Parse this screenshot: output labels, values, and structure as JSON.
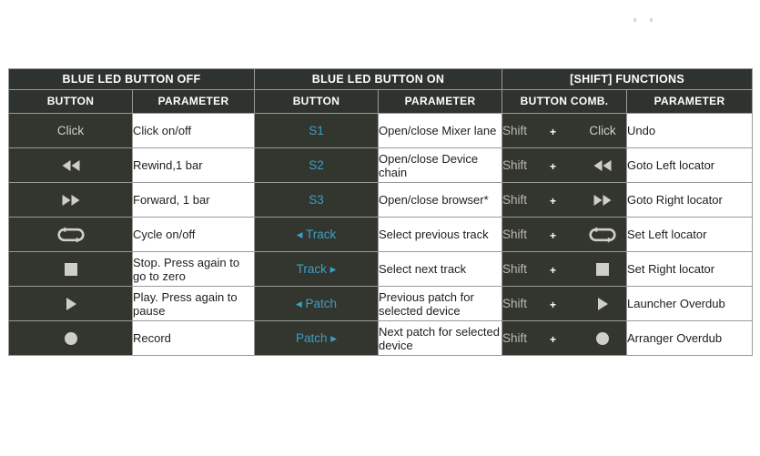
{
  "table": {
    "group_headers": [
      {
        "label": "BLUE LED BUTTON OFF",
        "span": 2
      },
      {
        "label": "BLUE LED BUTTON ON",
        "span": 2
      },
      {
        "label": "[SHIFT] FUNCTIONS",
        "span": 2
      }
    ],
    "sub_headers": [
      "BUTTON",
      "PARAMETER",
      "BUTTON",
      "PARAMETER",
      "BUTTON COMB.",
      "PARAMETER"
    ],
    "colors": {
      "dark_cell": "#32362f",
      "header_cell": "#2f332f",
      "blue_text": "#3c9fc4",
      "light_text": "#cfcfc8",
      "shift_text": "#b9b9b2",
      "border": "#9a9a9a",
      "param_bg": "#ffffff",
      "param_text": "#1d1d1d"
    },
    "rows": [
      {
        "off_button": {
          "type": "text",
          "label": "Click",
          "icon": ""
        },
        "off_parameter": "Click on/off",
        "on_button": "S1",
        "on_parameter": "Open/close Mixer lane",
        "shift_modifier": "Shift",
        "shift_plus": "+",
        "shift_key": {
          "type": "text",
          "label": "Click",
          "icon": ""
        },
        "shift_parameter": "Undo"
      },
      {
        "off_button": {
          "type": "icon",
          "label": "",
          "icon": "rewind-icon"
        },
        "off_parameter": "Rewind,1 bar",
        "on_button": "S2",
        "on_parameter": "Open/close Device chain",
        "shift_modifier": "Shift",
        "shift_plus": "+",
        "shift_key": {
          "type": "icon",
          "label": "",
          "icon": "rewind-icon"
        },
        "shift_parameter": "Goto Left locator"
      },
      {
        "off_button": {
          "type": "icon",
          "label": "",
          "icon": "forward-icon"
        },
        "off_parameter": "Forward, 1 bar",
        "on_button": "S3",
        "on_parameter": "Open/close browser*",
        "shift_modifier": "Shift",
        "shift_plus": "+",
        "shift_key": {
          "type": "icon",
          "label": "",
          "icon": "forward-icon"
        },
        "shift_parameter": "Goto Right locator"
      },
      {
        "off_button": {
          "type": "icon",
          "label": "",
          "icon": "cycle-loop-icon"
        },
        "off_parameter": "Cycle on/off",
        "on_button": "◂ Track",
        "on_parameter": "Select previous track",
        "shift_modifier": "Shift",
        "shift_plus": "+",
        "shift_key": {
          "type": "icon",
          "label": "",
          "icon": "cycle-loop-icon"
        },
        "shift_parameter": "Set Left locator"
      },
      {
        "off_button": {
          "type": "icon",
          "label": "",
          "icon": "stop-icon"
        },
        "off_parameter": "Stop. Press again to go to zero",
        "on_button": "Track ▸",
        "on_parameter": "Select next track",
        "shift_modifier": "Shift",
        "shift_plus": "+",
        "shift_key": {
          "type": "icon",
          "label": "",
          "icon": "stop-icon"
        },
        "shift_parameter": "Set Right locator"
      },
      {
        "off_button": {
          "type": "icon",
          "label": "",
          "icon": "play-icon"
        },
        "off_parameter": "Play. Press again to pause",
        "on_button": "◂ Patch",
        "on_parameter": "Previous patch for selected device",
        "shift_modifier": "Shift",
        "shift_plus": "+",
        "shift_key": {
          "type": "icon",
          "label": "",
          "icon": "play-icon"
        },
        "shift_parameter": "Launcher Overdub"
      },
      {
        "off_button": {
          "type": "icon",
          "label": "",
          "icon": "record-icon"
        },
        "off_parameter": "Record",
        "on_button": "Patch ▸",
        "on_parameter": "Next patch for selected device",
        "shift_modifier": "Shift",
        "shift_plus": "+",
        "shift_key": {
          "type": "icon",
          "label": "",
          "icon": "record-icon"
        },
        "shift_parameter": "Arranger Overdub"
      }
    ]
  }
}
